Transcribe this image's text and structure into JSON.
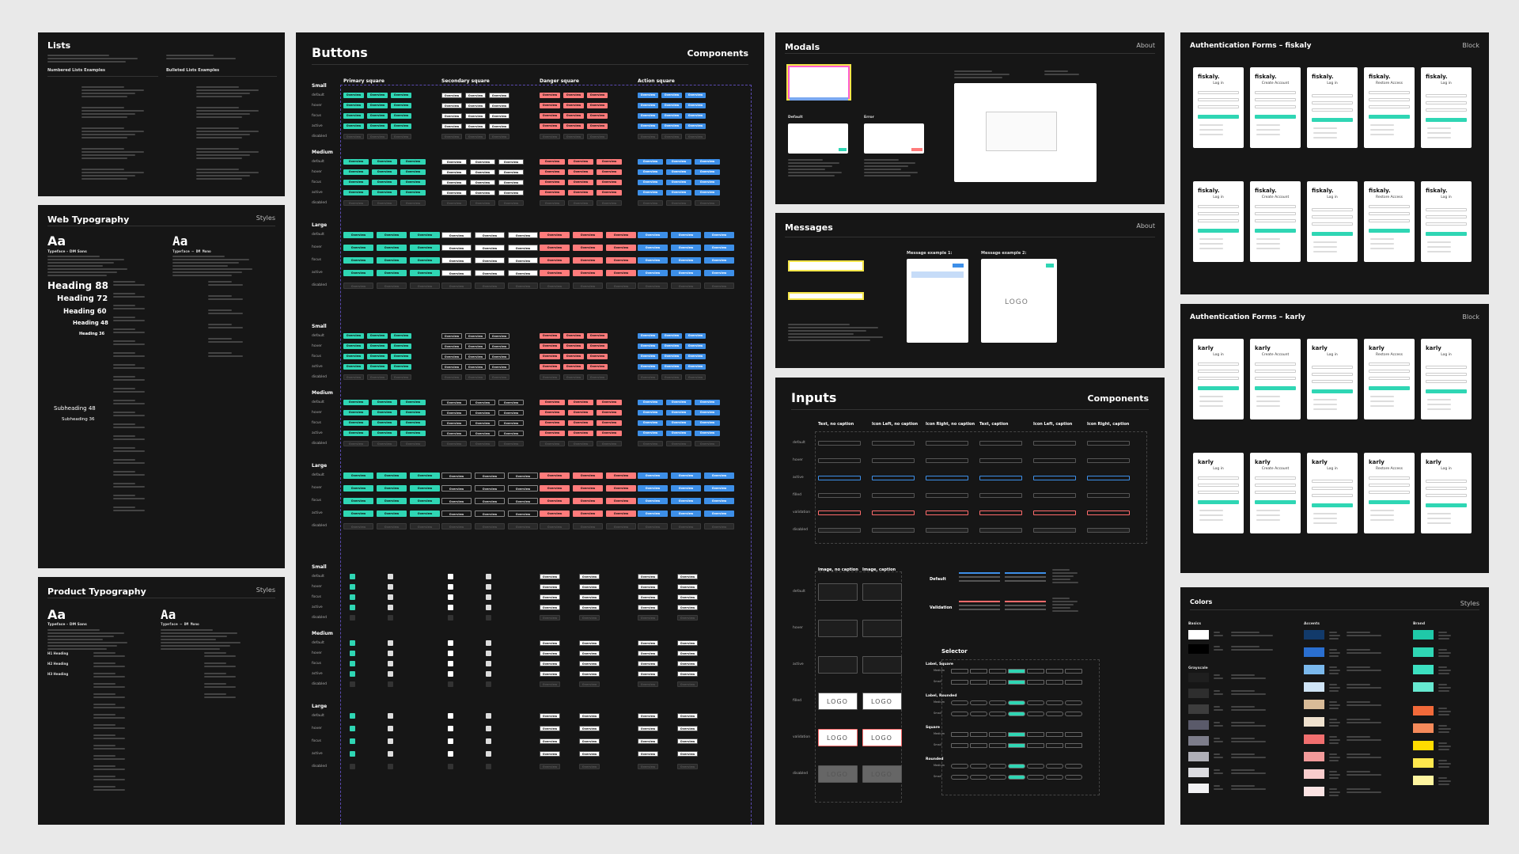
{
  "lists": {
    "title": "Lists",
    "numbered": "Numbered Lists Examples",
    "bulleted": "Bulleted Lists Examples"
  },
  "web_typo": {
    "title": "Web Typography",
    "right": "Styles",
    "aa": "Aa",
    "sans": "Typeface – DM Sans",
    "mono": "Typeface – DM Mono",
    "headings": [
      "Heading 88",
      "Heading 72",
      "Heading 60",
      "Heading 48",
      "Heading 36"
    ],
    "subs": [
      "Subheading 48",
      "Subheading 36"
    ]
  },
  "prod_typo": {
    "title": "Product Typography",
    "right": "Styles",
    "aa": "Aa",
    "sans": "Typeface – DM Sans",
    "mono": "Typeface – DM Mono",
    "h_labels": [
      "H1 Heading",
      "H2 Heading",
      "H3 Heading"
    ]
  },
  "buttons": {
    "title": "Buttons",
    "right": "Components",
    "cols": [
      "Primary square",
      "Secondary square",
      "Danger square",
      "Action square"
    ],
    "sizes": [
      "Small",
      "Medium",
      "Large"
    ],
    "states": [
      "default",
      "hover",
      "focus",
      "active",
      "disabled"
    ],
    "label": "Overview"
  },
  "modals": {
    "title": "Modals",
    "right": "About",
    "default": "Default",
    "error": "Error"
  },
  "messages": {
    "title": "Messages",
    "right": "About",
    "ex1": "Message example 1:",
    "ex2": "Message example 2:",
    "logo": "LOGO"
  },
  "inputs": {
    "title": "Inputs",
    "right": "Components",
    "cols": [
      "Text, no caption",
      "Icon Left, no caption",
      "Icon Right, no caption",
      "Text, caption",
      "Icon Left, caption",
      "Icon Right, caption"
    ],
    "rows": [
      "default",
      "hover",
      "active",
      "filled",
      "validation",
      "disabled"
    ],
    "img_cols": [
      "Image, no caption",
      "Image, caption"
    ],
    "img_rows": [
      "default",
      "hover",
      "active",
      "filled",
      "validation",
      "disabled"
    ],
    "slider_rows": [
      "Default",
      "Validation"
    ],
    "selector": "Selector",
    "sel_groups": [
      "Label, Square",
      "Label, Rounded",
      "Square",
      "Rounded"
    ],
    "sel_sizes": [
      "Medium",
      "Small"
    ],
    "logo": "LOGO"
  },
  "auth1": {
    "title": "Authentication Forms – fiskaly",
    "right": "Block",
    "brand": "fiskaly."
  },
  "auth2": {
    "title": "Authentication Forms – karly",
    "right": "Block",
    "brand": "karly"
  },
  "auth_titles": [
    "Log in",
    "Create Account",
    "Log in",
    "Restore Access",
    "Log in"
  ],
  "colors": {
    "title": "Colors",
    "right": "Styles",
    "groups": [
      "Basics",
      "Accents",
      "Brand",
      "Grayscale"
    ],
    "basics": [
      "#ffffff",
      "#000000"
    ],
    "grays": [
      "#1f1f1f",
      "#2e2e2e",
      "#3d3d3d",
      "#5a5a6a",
      "#7d7d8a",
      "#b0b0b8",
      "#dcdce0",
      "#f2f2f4"
    ],
    "accents": [
      "#123a6a",
      "#2a6fd0",
      "#7ab8ec",
      "#cfe4f6",
      "#d8bb98",
      "#efe1ce",
      "#f16f6f",
      "#f29a9a",
      "#f8cccc",
      "#fbe3e3"
    ],
    "brand": [
      "#1fc9a8",
      "#2fd6b4",
      "#3ce0c0",
      "#66e8cf",
      "#f26a3a",
      "#f58a5a",
      "#ffdc00",
      "#ffe84d",
      "#fff5a0"
    ]
  }
}
